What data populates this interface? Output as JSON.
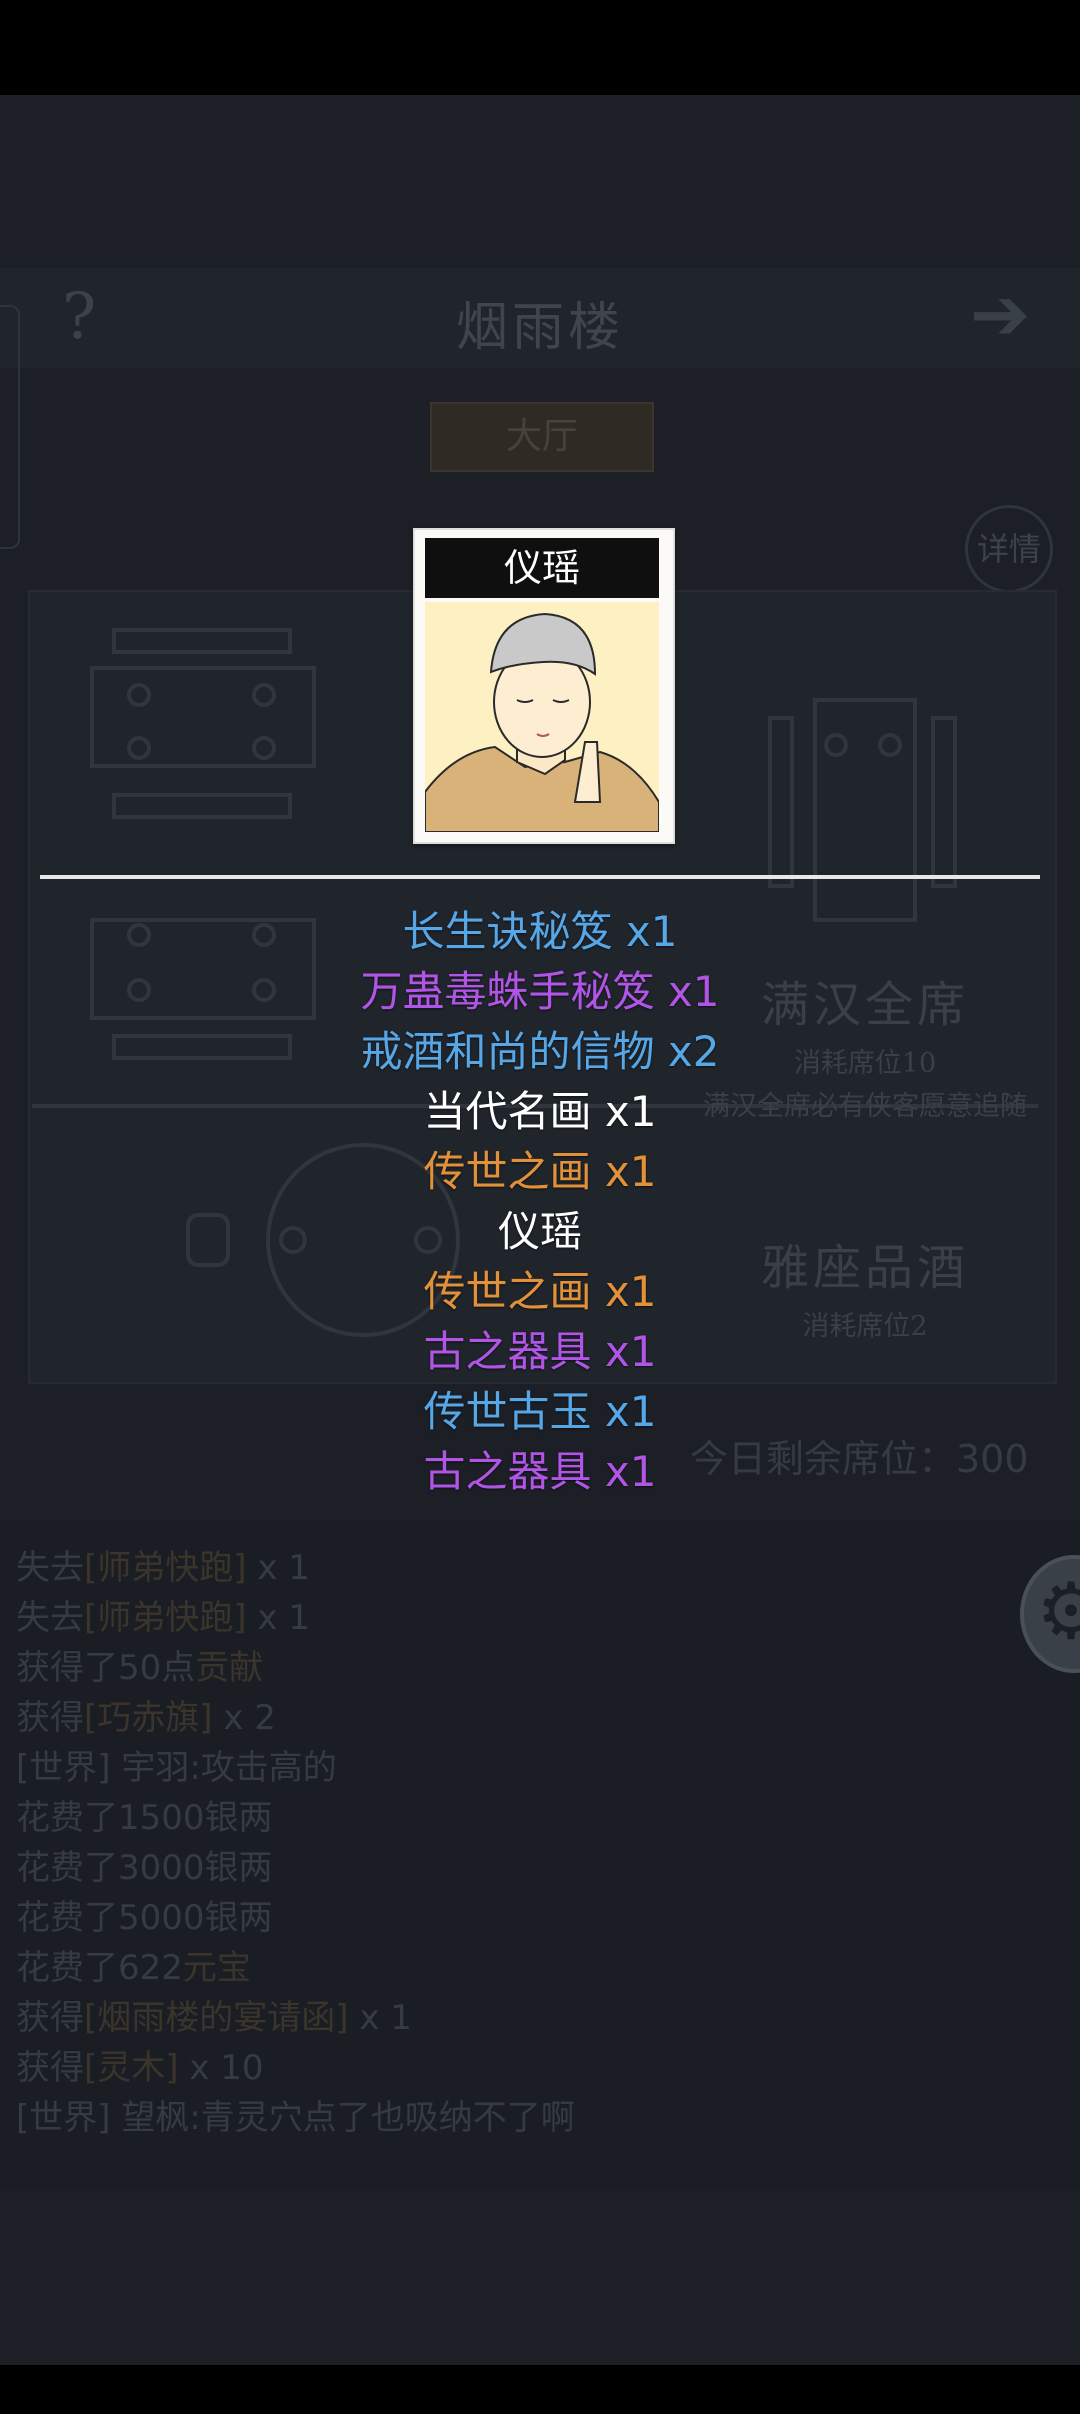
{
  "header": {
    "title": "烟雨楼",
    "help_icon": "?",
    "next_icon": "➔"
  },
  "tabs": {
    "hall": "大厅"
  },
  "detail_button": "详情",
  "menu": [
    {
      "name": "满汉全席",
      "cost": "消耗席位10",
      "desc": "满汉全席必有侠客愿意追随"
    },
    {
      "name": "雅座品酒",
      "cost": "消耗席位2",
      "desc": ""
    }
  ],
  "seats_left": "今日剩余席位：300",
  "log": [
    {
      "pre": "失去",
      "hl": "[师弟快跑]",
      "post": " x 1"
    },
    {
      "pre": "失去",
      "hl": "[师弟快跑]",
      "post": " x 1"
    },
    {
      "pre": "获得了50点",
      "hl": "贡献",
      "post": ""
    },
    {
      "pre": "获得",
      "hl": "[巧赤旗]",
      "post": " x 2"
    },
    {
      "pre": "[世界] 宇羽:攻击高的",
      "hl": "",
      "post": ""
    },
    {
      "pre": "花费了1500银两",
      "hl": "",
      "post": ""
    },
    {
      "pre": "花费了3000银两",
      "hl": "",
      "post": ""
    },
    {
      "pre": "花费了5000银两",
      "hl": "",
      "post": ""
    },
    {
      "pre": "花费了622",
      "hl": "元宝",
      "post": ""
    },
    {
      "pre": "获得",
      "hl": "[烟雨楼的宴请函]",
      "post": " x 1"
    },
    {
      "pre": "获得",
      "hl": "[灵木]",
      "post": " x 10"
    },
    {
      "pre": "[世界] 望枫:青灵穴点了也吸纳不了啊",
      "hl": "",
      "post": ""
    }
  ],
  "popup": {
    "character_name": "仪瑶",
    "rewards": [
      {
        "text": "长生诀秘笈 x1",
        "color": "#57a6e6"
      },
      {
        "text": "万蛊毒蛛手秘笈 x1",
        "color": "#b055e6"
      },
      {
        "text": "戒酒和尚的信物 x2",
        "color": "#57a6e6"
      },
      {
        "text": "当代名画 x1",
        "color": "#ffffff"
      },
      {
        "text": "传世之画 x1",
        "color": "#e0913a"
      },
      {
        "text": "仪瑶",
        "color": "#ffffff"
      },
      {
        "text": "传世之画 x1",
        "color": "#e0913a"
      },
      {
        "text": "古之器具 x1",
        "color": "#b055e6"
      },
      {
        "text": "传世古玉 x1",
        "color": "#57a6e6"
      },
      {
        "text": "古之器具 x1",
        "color": "#b055e6"
      }
    ]
  },
  "icons": {
    "settings": "gear-icon",
    "help": "question-icon",
    "next": "arrow-right-icon"
  }
}
